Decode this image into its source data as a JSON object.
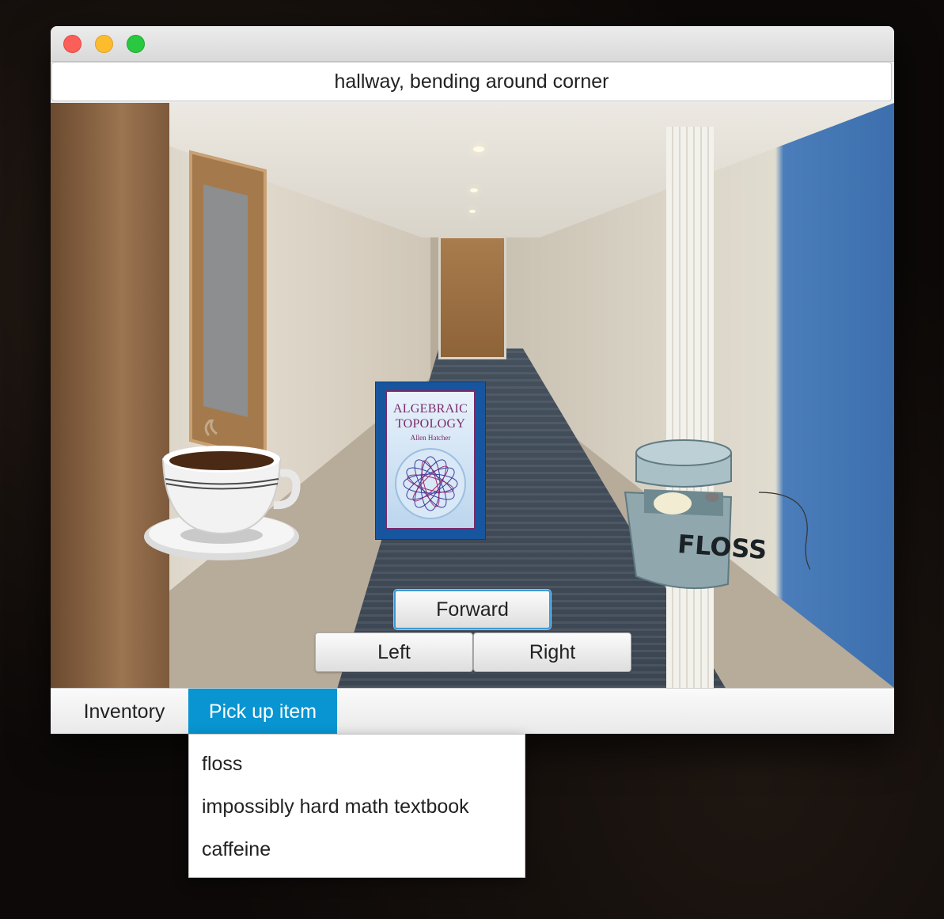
{
  "window": {
    "location": "hallway, bending around corner"
  },
  "scene": {
    "items": [
      {
        "name": "caffeine",
        "icon": "coffee-cup-icon"
      },
      {
        "name": "impossibly hard math textbook",
        "icon": "textbook-icon",
        "cover_title_line1": "ALGEBRAIC",
        "cover_title_line2": "TOPOLOGY",
        "cover_author": "Allen Hatcher"
      },
      {
        "name": "floss",
        "icon": "floss-icon",
        "label": "FLOSS"
      }
    ]
  },
  "navigation": {
    "forward": "Forward",
    "left": "Left",
    "right": "Right"
  },
  "menubar": {
    "inventory": "Inventory",
    "pickup": "Pick up item",
    "active_menu": "pickup"
  },
  "pickup_menu": {
    "items": [
      "floss",
      "impossibly hard math textbook",
      "caffeine"
    ]
  },
  "colors": {
    "accent": "#0895d1",
    "focus_ring": "#3b9ad9"
  }
}
